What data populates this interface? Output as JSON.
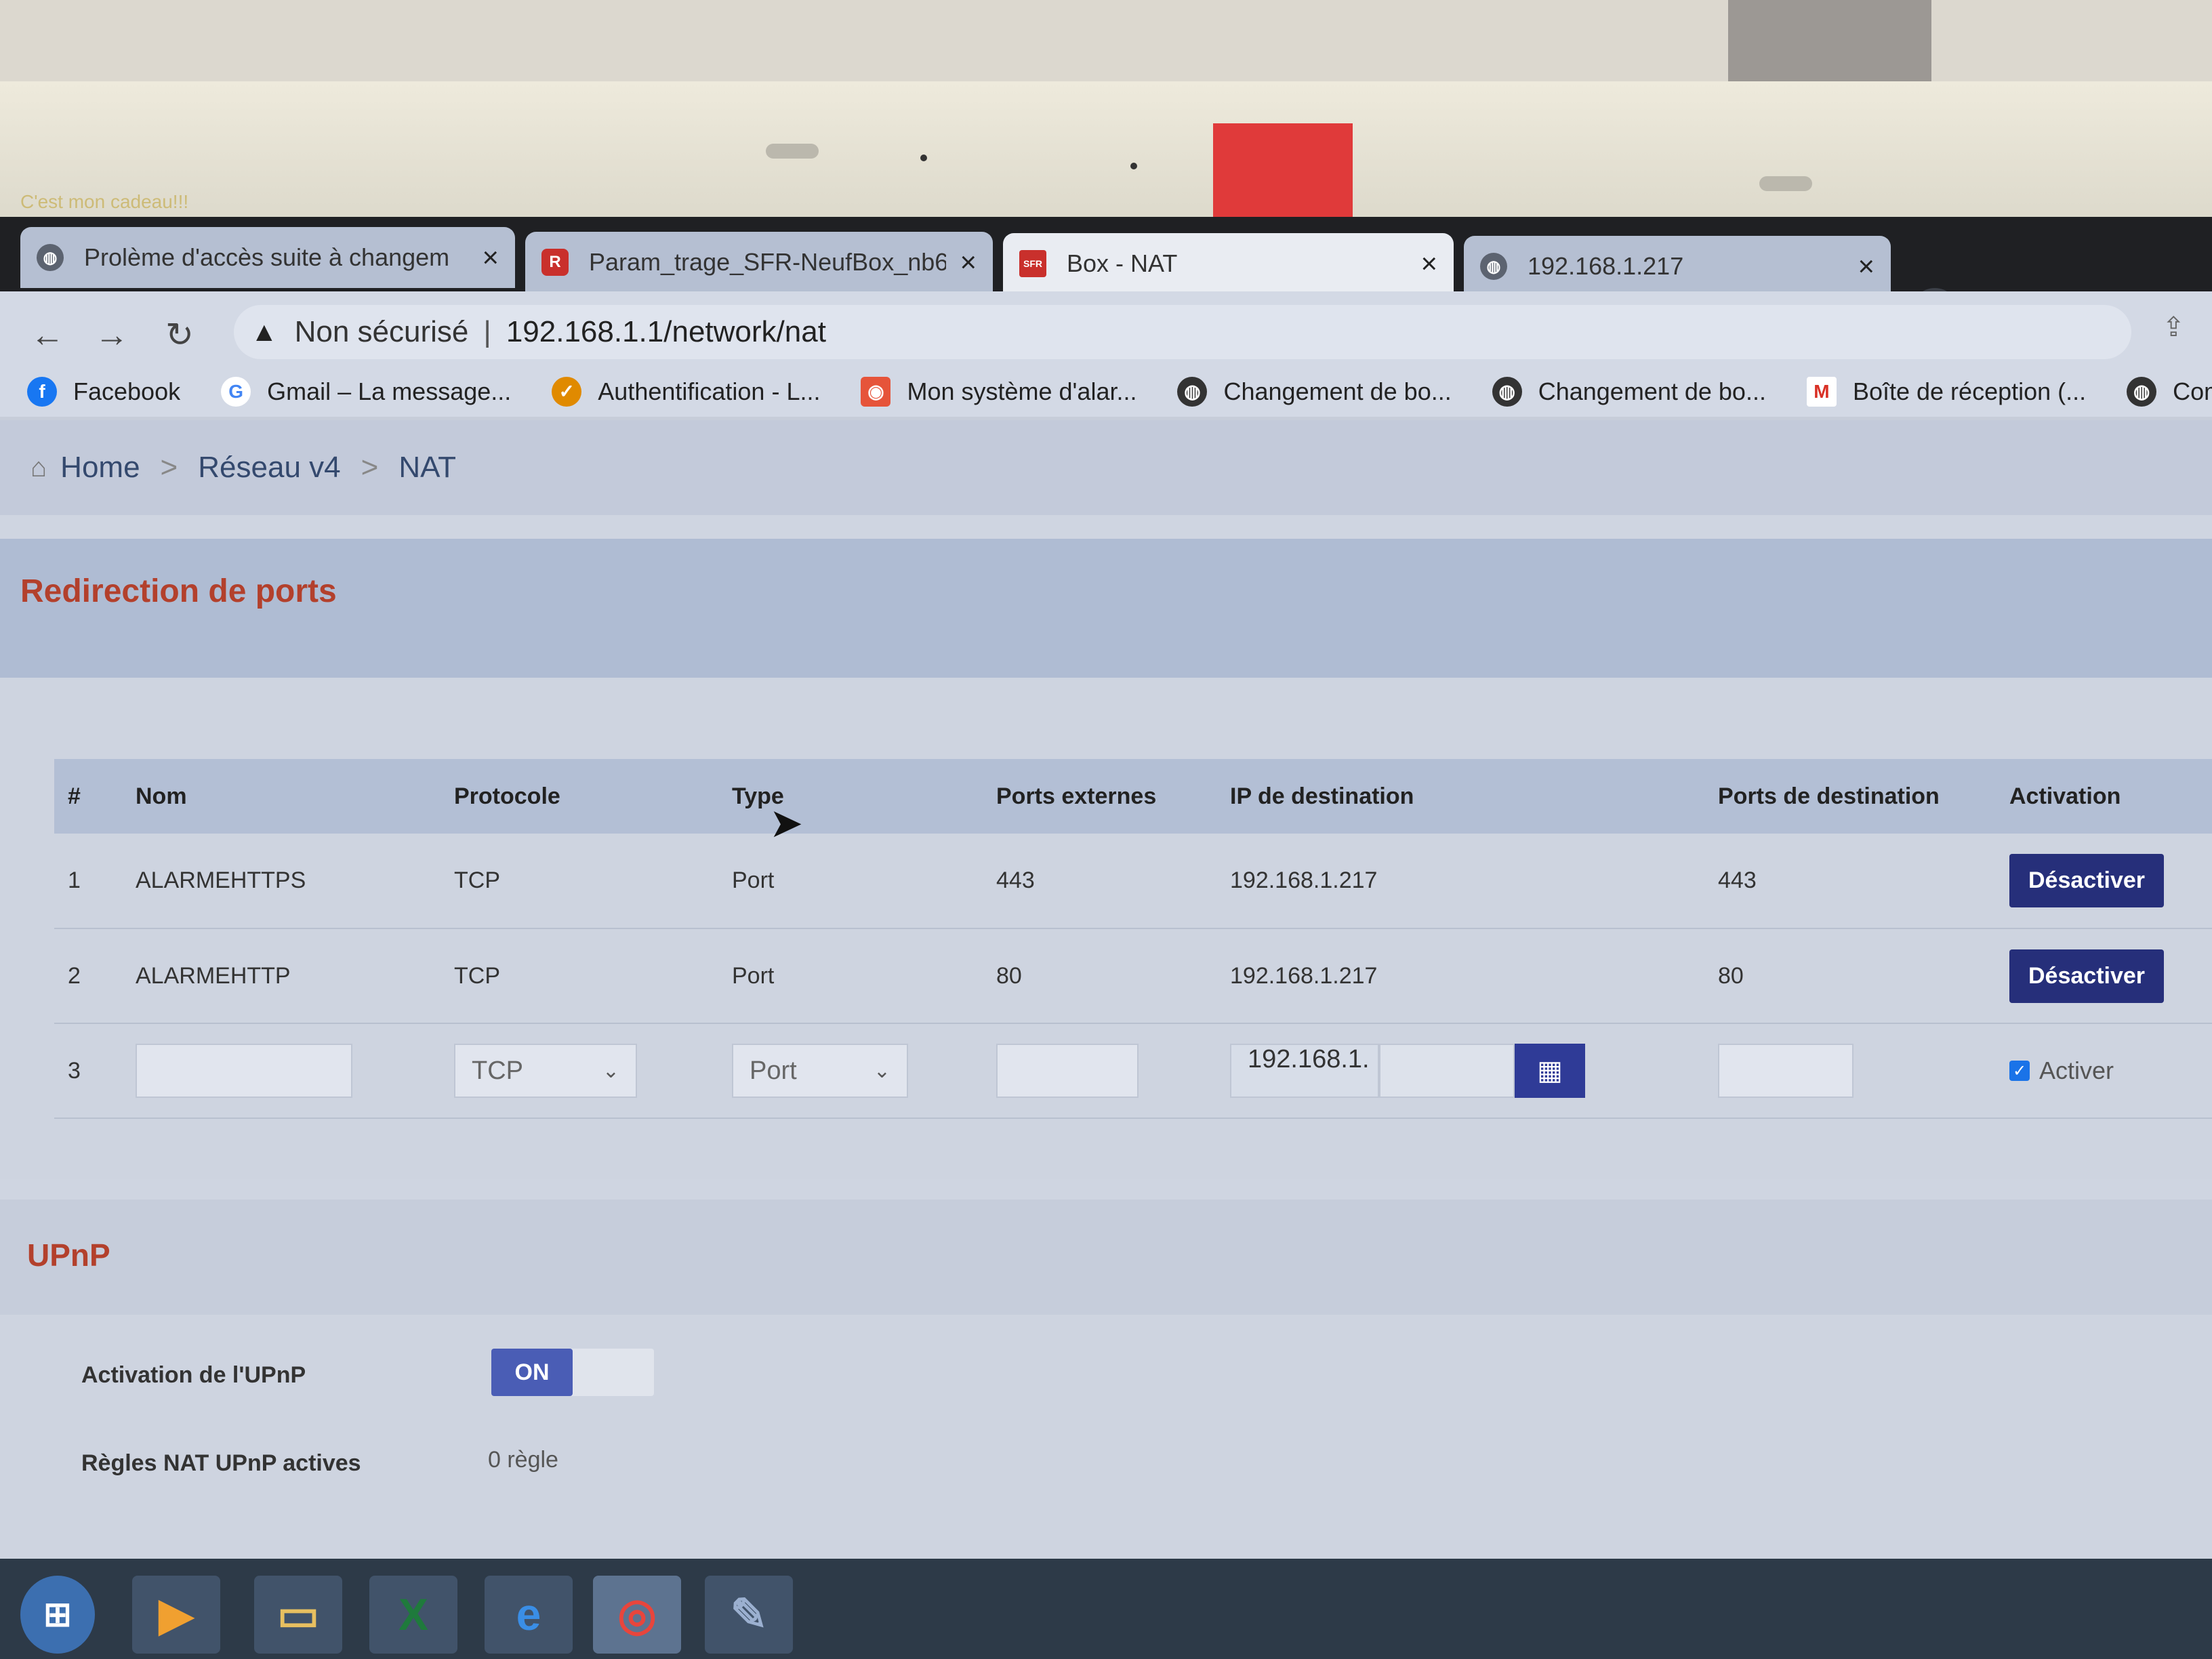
{
  "sticker_note": "C'est mon cadeau!!!",
  "tabs": [
    {
      "title": "Prolème d'accès suite à changem",
      "icon": "globe-icon",
      "active": false
    },
    {
      "title": "Param_trage_SFR-NeufBox_nb6_",
      "icon": "r-app-icon",
      "active": false
    },
    {
      "title": "Box - NAT",
      "icon": "sfr-icon",
      "active": true
    },
    {
      "title": "192.168.1.217",
      "icon": "globe-icon",
      "active": false
    }
  ],
  "toolbar": {
    "security": "Non sécurisé",
    "separator": "|",
    "url": "192.168.1.1/network/nat"
  },
  "bookmarks": [
    {
      "label": "Facebook",
      "icon": "facebook-icon",
      "color": "#1877f2"
    },
    {
      "label": "Gmail – La message...",
      "icon": "google-icon",
      "color": "#4285f4"
    },
    {
      "label": "Authentification - L...",
      "icon": "bird-icon",
      "color": "#e08a00"
    },
    {
      "label": "Mon système d'alar...",
      "icon": "target-icon",
      "color": "#e6543a"
    },
    {
      "label": "Changement de bo...",
      "icon": "globe-icon",
      "color": "#333333"
    },
    {
      "label": "Changement de bo...",
      "icon": "globe-icon",
      "color": "#333333"
    },
    {
      "label": "Boîte de réception (...",
      "icon": "gmail-icon",
      "color": "#d93025"
    },
    {
      "label": "Comment ouvrir les",
      "icon": "globe-icon",
      "color": "#333333"
    }
  ],
  "breadcrumb": {
    "home": "Home",
    "sep": ">",
    "level2": "Réseau v4",
    "level3": "NAT"
  },
  "ports": {
    "title": "Redirection de ports",
    "columns": [
      "#",
      "Nom",
      "Protocole",
      "Type",
      "Ports externes",
      "IP de destination",
      "Ports de destination",
      "Activation"
    ],
    "rows": [
      {
        "num": "1",
        "name": "ALARMEHTTPS",
        "protocol": "TCP",
        "type": "Port",
        "ext_ports": "443",
        "dest_ip": "192.168.1.217",
        "dest_ports": "443",
        "action": "Désactiver"
      },
      {
        "num": "2",
        "name": "ALARMEHTTP",
        "protocol": "TCP",
        "type": "Port",
        "ext_ports": "80",
        "dest_ip": "192.168.1.217",
        "dest_ports": "80",
        "action": "Désactiver"
      }
    ],
    "new_row": {
      "num": "3",
      "protocol_value": "TCP",
      "type_value": "Port",
      "ip_prefix": "192.168.1.",
      "activate_label": "Activer",
      "activate_checked": true
    }
  },
  "upnp": {
    "title": "UPnP",
    "activation_label": "Activation de l'UPnP",
    "toggle": "ON",
    "rules_label": "Règles NAT UPnP actives",
    "rules_value": "0 règle"
  },
  "colors": {
    "accent_title": "#b3402c",
    "button": "#262f7a"
  }
}
